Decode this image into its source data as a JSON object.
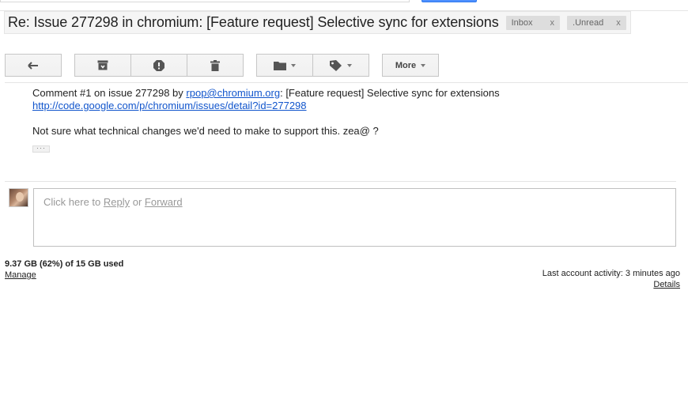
{
  "subject": {
    "title": "Re: Issue 277298 in chromium: [Feature request] Selective sync for extensions",
    "labels": [
      {
        "name": "Inbox",
        "remove": "x"
      },
      {
        "name": ".Unread",
        "remove": "x"
      }
    ]
  },
  "toolbar": {
    "reply_icon": "reply-icon",
    "archive_icon": "archive-icon",
    "spam_icon": "report-spam-icon",
    "delete_icon": "trash-icon",
    "move_icon": "folder-icon",
    "labels_icon": "label-tag-icon",
    "more_label": "More"
  },
  "message": {
    "intro_prefix": "Comment #1 on issue 277298 by ",
    "author_email": "rpop@chromium.org",
    "intro_suffix": ": [Feature request] Selective sync for extensions",
    "issue_link": "http://code.google.com/p/chromium/issues/detail?id=277298",
    "body": "Not sure what technical changes we'd need to make to support this. zea@ ?",
    "show_trimmed": "···"
  },
  "reply": {
    "prompt_prefix": "Click here to ",
    "reply_link": "Reply",
    "separator": " or ",
    "forward_link": "Forward"
  },
  "footer": {
    "quota": "9.37 GB (62%) of 15 GB used",
    "manage": "Manage",
    "last_activity": "Last account activity: 3 minutes ago",
    "details": "Details"
  },
  "colors": {
    "link": "#1155cc",
    "toolbar_bg": "#f5f5f5",
    "label_chip": "#dddddd"
  }
}
